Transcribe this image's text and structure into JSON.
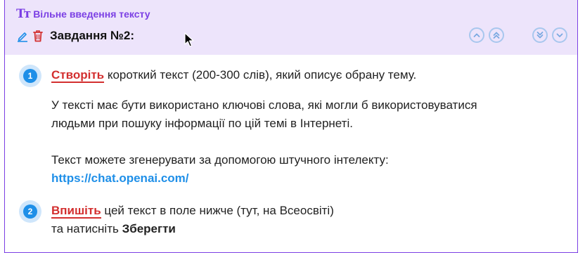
{
  "header": {
    "type_icon": "Tт",
    "type_label": "Вільне введення тексту",
    "task_title": "Завдання №2:",
    "nav_buttons": [
      "chevron-up",
      "double-chevron-up",
      "double-chevron-down",
      "chevron-down"
    ]
  },
  "steps": [
    {
      "number": "1",
      "keyword": "Створіть",
      "text": " короткий текст (200-300 слів), який описує обрану тему."
    },
    {
      "number": "2",
      "keyword": "Впишіть",
      "text": " цей текст в поле нижче (тут, на Всеосвіті)",
      "line2_prefix": "та натисніть ",
      "line2_bold": "Зберегти"
    }
  ],
  "paragraphs": {
    "keywords_line1": "У тексті має бути використано ключові слова, які могли б використовуватися",
    "keywords_line2": "людьми при пошуку інформації по цій темі в Інтернеті.",
    "ai_line": "Текст можете згенерувати за допомогою штучного інтелекту:",
    "ai_link": "https://chat.openai.com/"
  },
  "colors": {
    "accent_purple": "#7b3fe4",
    "header_bg": "#ede4fb",
    "keyword_red": "#d32f2f",
    "link_blue": "#1e8fe8"
  }
}
